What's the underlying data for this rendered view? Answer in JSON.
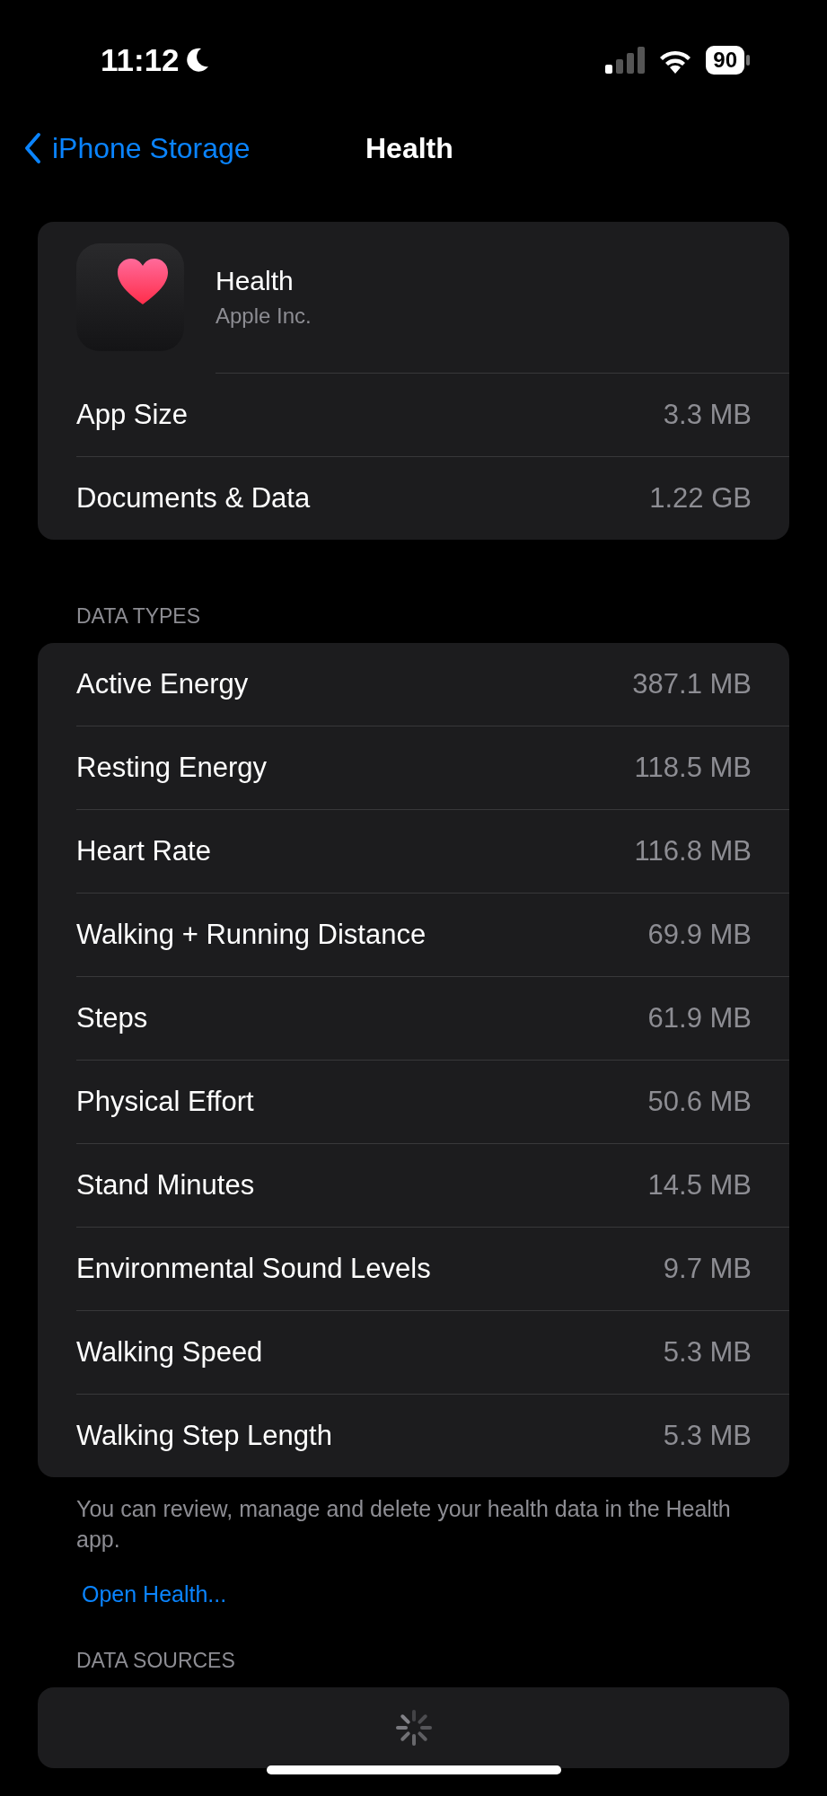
{
  "status_bar": {
    "time": "11:12",
    "battery": "90"
  },
  "nav": {
    "back_label": "iPhone Storage",
    "title": "Health"
  },
  "app": {
    "name": "Health",
    "developer": "Apple Inc.",
    "rows": [
      {
        "label": "App Size",
        "value": "3.3 MB"
      },
      {
        "label": "Documents & Data",
        "value": "1.22 GB"
      }
    ]
  },
  "data_types": {
    "header": "DATA TYPES",
    "rows": [
      {
        "label": "Active Energy",
        "value": "387.1 MB"
      },
      {
        "label": "Resting Energy",
        "value": "118.5 MB"
      },
      {
        "label": "Heart Rate",
        "value": "116.8 MB"
      },
      {
        "label": "Walking + Running Distance",
        "value": "69.9 MB"
      },
      {
        "label": "Steps",
        "value": "61.9 MB"
      },
      {
        "label": "Physical Effort",
        "value": "50.6 MB"
      },
      {
        "label": "Stand Minutes",
        "value": "14.5 MB"
      },
      {
        "label": "Environmental Sound Levels",
        "value": "9.7 MB"
      },
      {
        "label": "Walking Speed",
        "value": "5.3 MB"
      },
      {
        "label": "Walking Step Length",
        "value": "5.3 MB"
      }
    ],
    "footer": "You can review, manage and delete your health data in the Health app.",
    "link": "Open Health..."
  },
  "data_sources": {
    "header": "DATA SOURCES",
    "loading": true
  }
}
